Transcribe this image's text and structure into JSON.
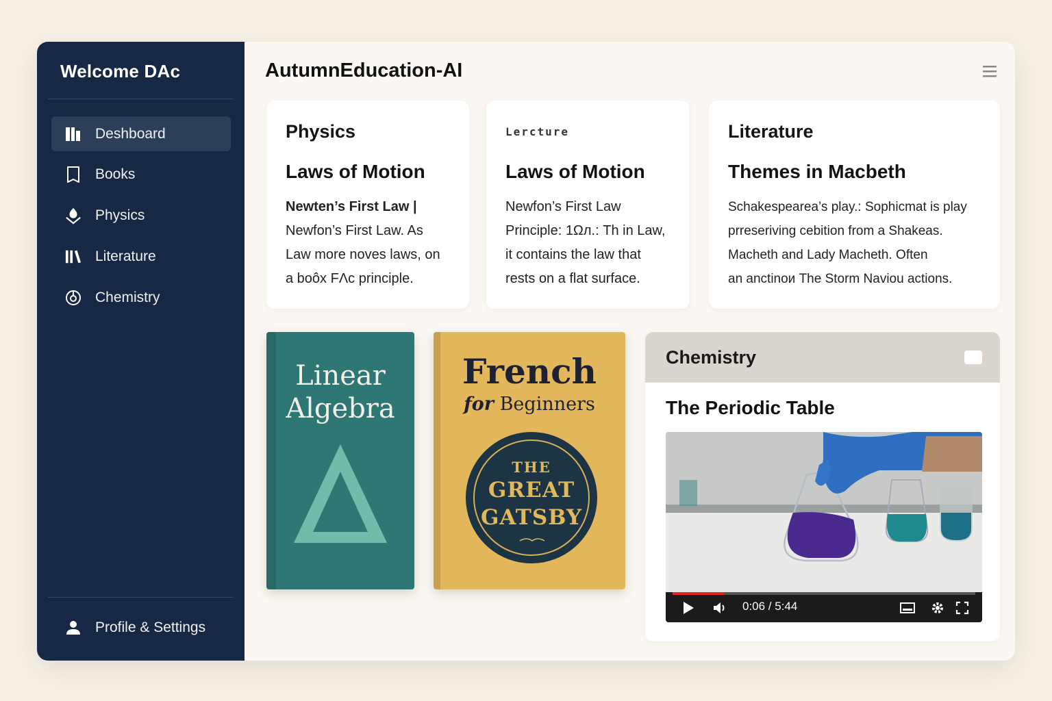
{
  "sidebar": {
    "welcome": "Welcome DAᴄ",
    "items": [
      {
        "label": "Deshboard",
        "icon": "dashboard-icon",
        "active": true
      },
      {
        "label": "Books",
        "icon": "book-icon"
      },
      {
        "label": "Physics",
        "icon": "physics-icon"
      },
      {
        "label": "Literature",
        "icon": "literature-icon"
      },
      {
        "label": "Chemistry",
        "icon": "chemistry-icon"
      }
    ],
    "profile": "Profile & Settings"
  },
  "header": {
    "title": "AutumnEducation-AI"
  },
  "cards": [
    {
      "kicker": "Physics",
      "title": "Laws of Motion",
      "lines": [
        "Newten’s First Law |",
        "Newfon’s First Law. As",
        "Law more noves laws, on",
        "a boôx FΛc principle."
      ]
    },
    {
      "kicker": "Lercture",
      "title": "Laws of Motion",
      "lines": [
        "Newfon’s First Law",
        "Principle: 1Ωл.: Th in Law,",
        "it contains the law that",
        "rests on a flat surface."
      ]
    },
    {
      "kicker": "Literature",
      "title": "Themes in Macbeth",
      "lines": [
        "Schakespearea’s play.: Sophicmat is play",
        "prreseriving cebition from a Shakeas.",
        "Macheth and Lady Macheth. Often",
        "an anctinoи The Storm Naviou actions."
      ]
    }
  ],
  "books": {
    "linear_algebra": {
      "line1": "Linear",
      "line2": "Algebra"
    },
    "french": {
      "title": "French",
      "sub_italic": "for",
      "sub": "Beginners"
    },
    "gatsby": {
      "line1": "THE",
      "line2": "GREAT",
      "line3": "GATSBY"
    }
  },
  "chemistry": {
    "kicker": "Chemistry",
    "title": "The Periodic Table",
    "video": {
      "current": "0:06",
      "total": "5:44",
      "time_text": "0:06 / 5:44",
      "progress": 0.017
    }
  },
  "colors": {
    "sidebar": "#162843",
    "accent_red": "#e52520",
    "book_teal": "#2e7775",
    "book_yellow": "#e3b75b",
    "gatsby_navy": "#1c3444"
  }
}
